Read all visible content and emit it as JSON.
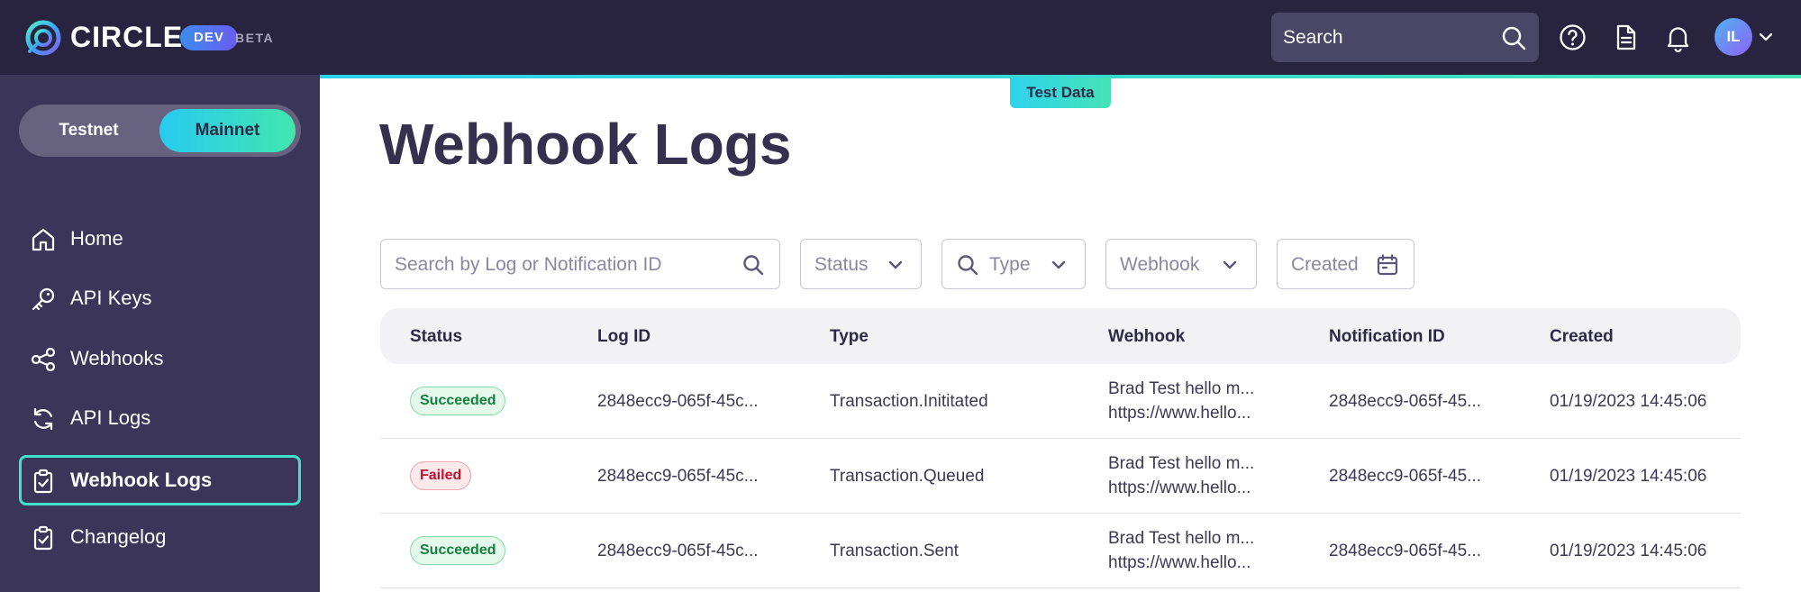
{
  "topbar": {
    "brand": "CIRCLE",
    "dev_badge": "DEV",
    "beta": "BETA",
    "search_placeholder": "Search",
    "avatar_initials": "IL"
  },
  "sidebar": {
    "net_toggle": {
      "testnet": "Testnet",
      "mainnet": "Mainnet",
      "selected": "Mainnet"
    },
    "items": [
      {
        "label": "Home",
        "icon": "home-icon"
      },
      {
        "label": "API Keys",
        "icon": "key-icon"
      },
      {
        "label": "Webhooks",
        "icon": "share-icon"
      },
      {
        "label": "API Logs",
        "icon": "refresh-icon"
      },
      {
        "label": "Webhook Logs",
        "icon": "clipboard-check-icon",
        "active": true
      },
      {
        "label": "Changelog",
        "icon": "clipboard-check-icon"
      }
    ]
  },
  "main": {
    "test_tag": "Test Data",
    "title": "Webhook Logs",
    "filters": {
      "search_placeholder": "Search by Log or Notification ID",
      "status": "Status",
      "type": "Type",
      "webhook": "Webhook",
      "created": "Created"
    },
    "table": {
      "columns": [
        "Status",
        "Log ID",
        "Type",
        "Webhook",
        "Notification ID",
        "Created"
      ],
      "rows": [
        {
          "status": "Succeeded",
          "log_id": "2848ecc9-065f-45c...",
          "type": "Transaction.Inititated",
          "webhook_name": "Brad Test hello m...",
          "webhook_url": "https://www.hello...",
          "notification_id": "2848ecc9-065f-45...",
          "created": "01/19/2023 14:45:06"
        },
        {
          "status": "Failed",
          "log_id": "2848ecc9-065f-45c...",
          "type": "Transaction.Queued",
          "webhook_name": "Brad Test hello m...",
          "webhook_url": "https://www.hello...",
          "notification_id": "2848ecc9-065f-45...",
          "created": "01/19/2023 14:45:06"
        },
        {
          "status": "Succeeded",
          "log_id": "2848ecc9-065f-45c...",
          "type": "Transaction.Sent",
          "webhook_name": "Brad Test hello m...",
          "webhook_url": "https://www.hello...",
          "notification_id": "2848ecc9-065f-45...",
          "created": "01/19/2023 14:45:06"
        }
      ]
    }
  },
  "colors": {
    "topbar_bg": "#28243f",
    "sidebar_bg": "#3b3659",
    "accent": "#44e0cf",
    "success": "#15803d",
    "failure": "#c8102e"
  }
}
